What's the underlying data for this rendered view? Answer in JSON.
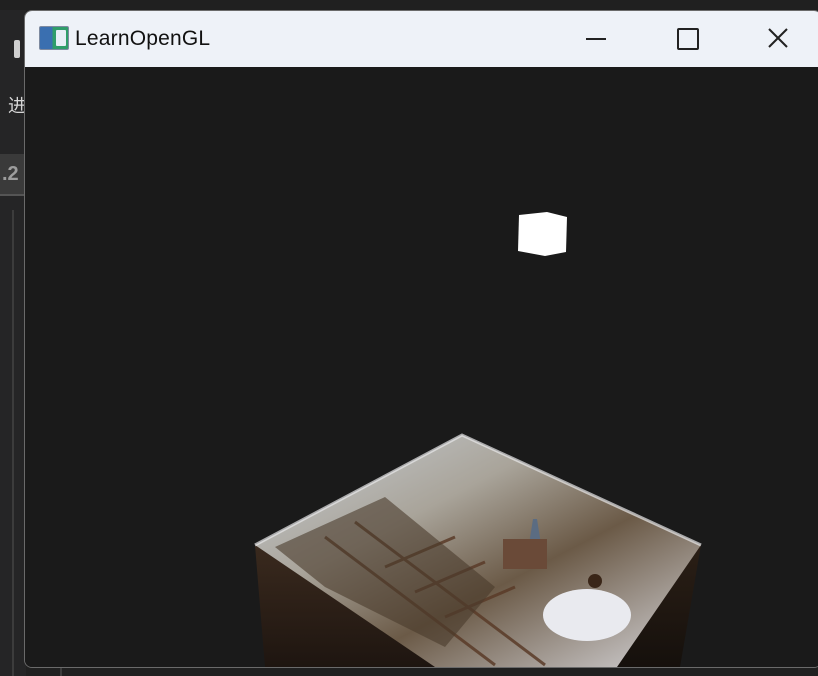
{
  "window": {
    "title": "LearnOpenGL",
    "icon": "opengl-app-icon",
    "controls": {
      "minimize": "minimize-icon",
      "maximize": "maximize-icon",
      "close": "close-icon"
    }
  },
  "background_app": {
    "side_char": "进",
    "tab_text": ".2"
  },
  "scene": {
    "background_color": "#1a1a1a",
    "light_cube_color": "#ffffff",
    "crate_top_description": "photo texture of railway tracks with a person in a white dress"
  }
}
